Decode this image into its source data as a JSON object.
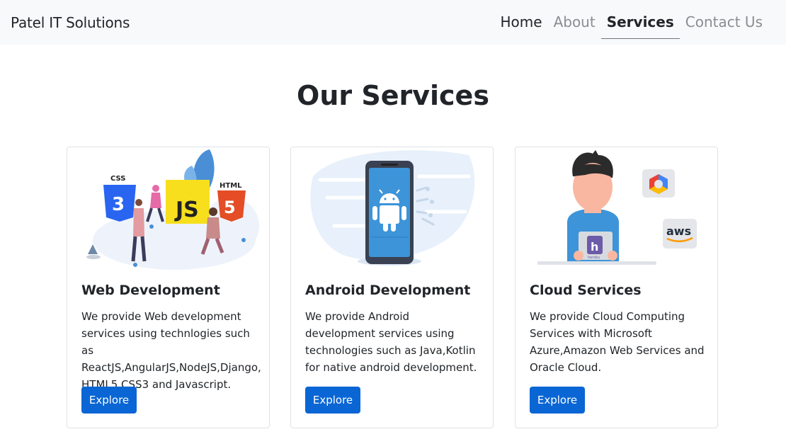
{
  "navbar": {
    "brand": "Patel IT Solutions",
    "links": [
      {
        "label": "Home"
      },
      {
        "label": "About"
      },
      {
        "label": "Services"
      },
      {
        "label": "Contact Us"
      }
    ]
  },
  "page": {
    "title": "Our Services"
  },
  "cards": [
    {
      "title": "Web Development",
      "text": "We provide Web development services using technlogies such as ReactJS,AngularJS,NodeJS,Django, HTML5,CSS3 and Javascript.",
      "button": "Explore",
      "image_labels": {
        "css": "CSS",
        "js": "JS",
        "html": "HTML"
      }
    },
    {
      "title": "Android Development",
      "text": "We provide Android development services using technologies such as Java,Kotlin for native android development.",
      "button": "Explore"
    },
    {
      "title": "Cloud Services",
      "text": "We provide Cloud Computing Services with Microsoft Azure,Amazon Web Services and Oracle Cloud.",
      "button": "Explore",
      "image_labels": {
        "aws": "aws",
        "heroku": "heroku"
      }
    }
  ],
  "colors": {
    "navbar_bg": "#f8f9fa",
    "button_bg": "#0a66d4",
    "android_blue": "#3d94d8",
    "accent_red": "#e44d26",
    "accent_yellow": "#f7df1e",
    "css_blue": "#2965f1"
  }
}
